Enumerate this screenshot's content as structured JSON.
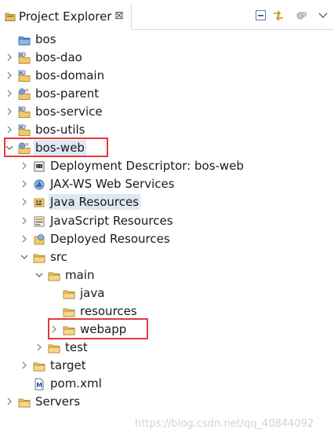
{
  "view": {
    "title": "Project Explorer",
    "close_glyph": "⊠",
    "toolbar": [
      "collapse-all-icon",
      "link-with-editor-icon",
      "focus-icon",
      "view-menu-icon"
    ]
  },
  "tree": {
    "items": [
      {
        "label": "bos",
        "depth": 0,
        "expandable": false,
        "expanded": false,
        "icon": "folder-project-icon"
      },
      {
        "label": "bos-dao",
        "depth": 0,
        "expandable": true,
        "expanded": false,
        "icon": "maven-project-icon"
      },
      {
        "label": "bos-domain",
        "depth": 0,
        "expandable": true,
        "expanded": false,
        "icon": "maven-project-icon"
      },
      {
        "label": "bos-parent",
        "depth": 0,
        "expandable": true,
        "expanded": false,
        "icon": "maven-web-project-icon"
      },
      {
        "label": "bos-service",
        "depth": 0,
        "expandable": true,
        "expanded": false,
        "icon": "maven-project-icon"
      },
      {
        "label": "bos-utils",
        "depth": 0,
        "expandable": true,
        "expanded": false,
        "icon": "maven-project-icon"
      },
      {
        "label": "bos-web",
        "depth": 0,
        "expandable": true,
        "expanded": true,
        "icon": "maven-web-project-icon",
        "selected": true,
        "highlighted": true
      },
      {
        "label": "Deployment Descriptor: bos-web",
        "depth": 1,
        "expandable": true,
        "expanded": false,
        "icon": "deployment-descriptor-icon"
      },
      {
        "label": "JAX-WS Web Services",
        "depth": 1,
        "expandable": true,
        "expanded": false,
        "icon": "web-services-icon"
      },
      {
        "label": "Java Resources",
        "depth": 1,
        "expandable": true,
        "expanded": false,
        "icon": "java-resources-icon",
        "selected": true
      },
      {
        "label": "JavaScript Resources",
        "depth": 1,
        "expandable": true,
        "expanded": false,
        "icon": "javascript-resources-icon"
      },
      {
        "label": "Deployed Resources",
        "depth": 1,
        "expandable": true,
        "expanded": false,
        "icon": "deployed-resources-icon"
      },
      {
        "label": "src",
        "depth": 1,
        "expandable": true,
        "expanded": true,
        "icon": "folder-icon"
      },
      {
        "label": "main",
        "depth": 2,
        "expandable": true,
        "expanded": true,
        "icon": "folder-icon"
      },
      {
        "label": "java",
        "depth": 3,
        "expandable": false,
        "expanded": false,
        "icon": "folder-icon"
      },
      {
        "label": "resources",
        "depth": 3,
        "expandable": false,
        "expanded": false,
        "icon": "folder-icon"
      },
      {
        "label": "webapp",
        "depth": 3,
        "expandable": true,
        "expanded": false,
        "icon": "folder-icon",
        "highlighted": true
      },
      {
        "label": "test",
        "depth": 2,
        "expandable": true,
        "expanded": false,
        "icon": "folder-icon"
      },
      {
        "label": "target",
        "depth": 1,
        "expandable": true,
        "expanded": false,
        "icon": "folder-icon"
      },
      {
        "label": "pom.xml",
        "depth": 1,
        "expandable": false,
        "expanded": false,
        "icon": "maven-pom-file-icon"
      },
      {
        "label": "Servers",
        "depth": 0,
        "expandable": true,
        "expanded": false,
        "icon": "folder-icon"
      }
    ]
  },
  "watermark": "https://blog.csdn.net/qq_40844092"
}
